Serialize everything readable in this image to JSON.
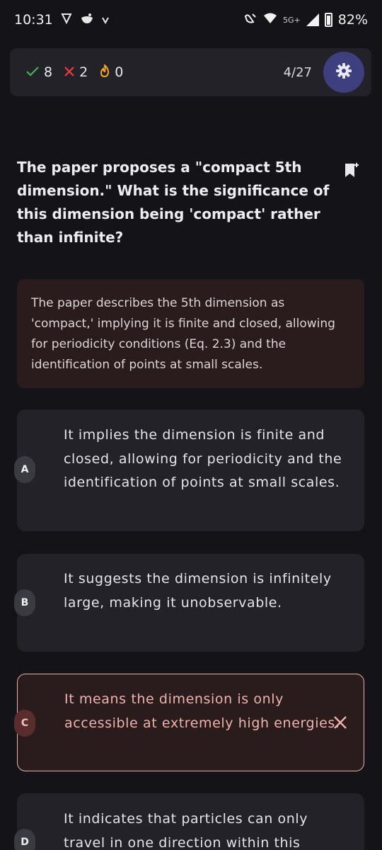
{
  "status_bar": {
    "time": "10:31",
    "network": "5G+",
    "battery": "82%"
  },
  "score": {
    "correct": "8",
    "wrong": "2",
    "streak": "0",
    "progress": "4/27"
  },
  "question": {
    "text": "The paper proposes a \"compact 5th dimension.\" What is the significance of this dimension being 'compact' rather than infinite?"
  },
  "explanation": {
    "text": "The paper describes the 5th dimension as 'compact,' implying it is finite and closed, allowing for periodicity conditions (Eq. 2.3) and the identification of points at small scales."
  },
  "options": [
    {
      "letter": "A",
      "text": "It implies the dimension is finite and closed, allowing for periodicity and the identification of points at small scales."
    },
    {
      "letter": "B",
      "text": "It suggests the dimension is infinitely large, making it unobservable."
    },
    {
      "letter": "C",
      "text": "It means the dimension is only accessible at extremely high energies.",
      "state": "incorrect"
    },
    {
      "letter": "D",
      "text": "It indicates that particles can only travel in one direction within this"
    }
  ],
  "colors": {
    "background": "#141418",
    "card": "#222228",
    "accent": "#3e3f7e",
    "correct": "#4caf50",
    "wrong": "#ef3b3b",
    "streak": "#f5a623",
    "incorrect_border": "#e6b3ad"
  },
  "icons": {
    "settings": "gear-icon",
    "bookmark": "bookmark-add-icon",
    "incorrect": "close-icon"
  }
}
